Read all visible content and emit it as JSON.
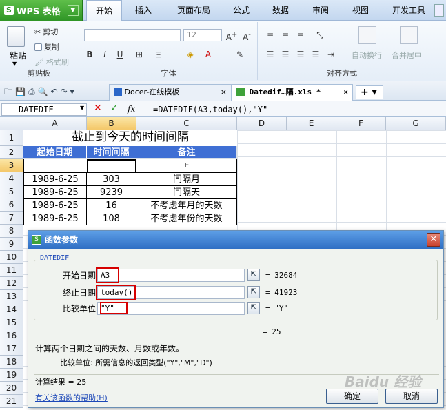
{
  "menu": {
    "app_button": "WPS 表格",
    "tabs": [
      "开始",
      "插入",
      "页面布局",
      "公式",
      "数据",
      "审阅",
      "视图",
      "开发工具"
    ]
  },
  "ribbon": {
    "paste": "粘贴",
    "cut": "剪切",
    "copy": "复制",
    "format_painter": "格式刷",
    "clipboard_group": "剪贴板",
    "font_size": "12",
    "font_group": "字体",
    "align_group": "对齐方式",
    "wrap": "自动换行",
    "merge": "合并居中"
  },
  "doc_tabs": {
    "tab1": "Docer-在线模板",
    "tab2": "Datedif…隔.xls *"
  },
  "formula_bar": {
    "name_box": "DATEDIF",
    "fx": "fx",
    "formula": "=DATEDIF(A3,today(),\"Y\""
  },
  "sheet": {
    "columns": [
      "A",
      "B",
      "C",
      "D",
      "E",
      "F",
      "G"
    ],
    "rows": [
      "1",
      "2",
      "3",
      "4",
      "5",
      "6",
      "7",
      "8",
      "9",
      "10",
      "11",
      "12",
      "13",
      "14",
      "15",
      "16",
      "17",
      "18",
      "19",
      "20",
      "21"
    ],
    "title": "截止到今天的时间间隔",
    "header": [
      "起始日期",
      "时间间隔",
      "备注"
    ],
    "row3_c": "E",
    "data": [
      [
        "1989-6-25",
        "303",
        "间隔月"
      ],
      [
        "1989-6-25",
        "9239",
        "间隔天"
      ],
      [
        "1989-6-25",
        "16",
        "不考虑年月的天数"
      ],
      [
        "1989-6-25",
        "108",
        "不考虑年份的天数"
      ]
    ]
  },
  "dialog": {
    "title": "函数参数",
    "func_name": "DATEDIF",
    "args": [
      {
        "label": "开始日期",
        "value": "A3",
        "result": "= 32684"
      },
      {
        "label": "终止日期",
        "value": "today()",
        "result": "= 41923"
      },
      {
        "label": "比较单位",
        "value": "\"Y\"",
        "result": "= \"Y\""
      }
    ],
    "overall": "= 25",
    "description": "计算两个日期之间的天数、月数或年数。",
    "param_help": "比较单位:  所需信息的返回类型(\"Y\",\"M\",\"D\")",
    "calc_result": "计算结果 = 25",
    "help_link": "有关该函数的帮助(H)",
    "ok": "确定",
    "cancel": "取消"
  },
  "watermark": "Baidu 经验",
  "colors": {
    "header_blue": "#3f6fd4",
    "highlight_red": "#d60000",
    "dialog_title": "#2f6fc4"
  }
}
